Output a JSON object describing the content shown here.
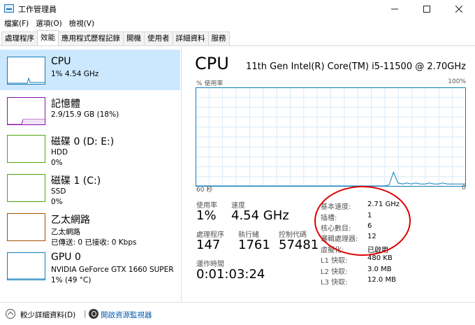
{
  "window": {
    "title": "工作管理員"
  },
  "menu": [
    "檔案(F)",
    "選項(O)",
    "檢視(V)"
  ],
  "tabs": [
    "處理程序",
    "效能",
    "應用程式歷程記錄",
    "開機",
    "使用者",
    "詳細資料",
    "服務"
  ],
  "active_tab": "效能",
  "sidebar": {
    "items": [
      {
        "name": "CPU",
        "sub1": "1% 4.54 GHz",
        "sub2": "",
        "color": "#117dbb",
        "active": true
      },
      {
        "name": "記憶體",
        "sub1": "2.9/15.9 GB (18%)",
        "sub2": "",
        "color": "#8b12ae",
        "active": false
      },
      {
        "name": "磁碟 0 (D: E:)",
        "sub1": "HDD",
        "sub2": "0%",
        "color": "#4da60c",
        "active": false
      },
      {
        "name": "磁碟 1 (C:)",
        "sub1": "SSD",
        "sub2": "0%",
        "color": "#4da60c",
        "active": false
      },
      {
        "name": "乙太網路",
        "sub1": "乙太網路",
        "sub2": "已傳送: 0 已接收: 0 Kbps",
        "color": "#a74f01",
        "active": false
      },
      {
        "name": "GPU 0",
        "sub1": "NVIDIA GeForce GTX 1660 SUPER",
        "sub2": "1% (49 °C)",
        "color": "#117dbb",
        "active": false
      }
    ]
  },
  "main": {
    "title": "CPU",
    "model": "11th Gen Intel(R) Core(TM) i5-11500 @ 2.70GHz",
    "graph_label_left": "% 使用率",
    "graph_label_right": "100%",
    "graph_bottom_left": "60 秒",
    "graph_bottom_right": "0",
    "stats": {
      "utilization_label": "使用率",
      "utilization": "1%",
      "speed_label": "速度",
      "speed": "4.54 GHz",
      "processes_label": "處理程序",
      "processes": "147",
      "threads_label": "執行緒",
      "threads": "1761",
      "handles_label": "控制代碼",
      "handles": "57481",
      "uptime_label": "運作時間",
      "uptime": "0:01:03:24"
    },
    "specs": [
      {
        "label": "基本速度:",
        "value": "2.71 GHz"
      },
      {
        "label": "插槽:",
        "value": "1"
      },
      {
        "label": "核心數目:",
        "value": "6"
      },
      {
        "label": "邏輯處理器:",
        "value": "12"
      },
      {
        "label": "虛擬化:",
        "value": "已啟用"
      },
      {
        "label": "L1 快取:",
        "value": "480 KB"
      },
      {
        "label": "L2 快取:",
        "value": "3.0 MB"
      },
      {
        "label": "L3 快取:",
        "value": "12.0 MB"
      }
    ],
    "graph_series": [
      0,
      0,
      0,
      0,
      0,
      0,
      0,
      0,
      0,
      0,
      0,
      0,
      0,
      0,
      0,
      0,
      0,
      0,
      0,
      0,
      0,
      0,
      0,
      0,
      0,
      0,
      0,
      0,
      0,
      0,
      0,
      0,
      0,
      0,
      0,
      0,
      0,
      0,
      0,
      0,
      0,
      0,
      0,
      1,
      14,
      3,
      2,
      3,
      2,
      3,
      2,
      2,
      3,
      2,
      2,
      3,
      2,
      2,
      2,
      2,
      2
    ],
    "annotation_color": "#e00000"
  },
  "footer": {
    "fewer_details": "較少詳細資料(D)",
    "separator": "|",
    "resource_monitor": "開啟資源監視器"
  }
}
